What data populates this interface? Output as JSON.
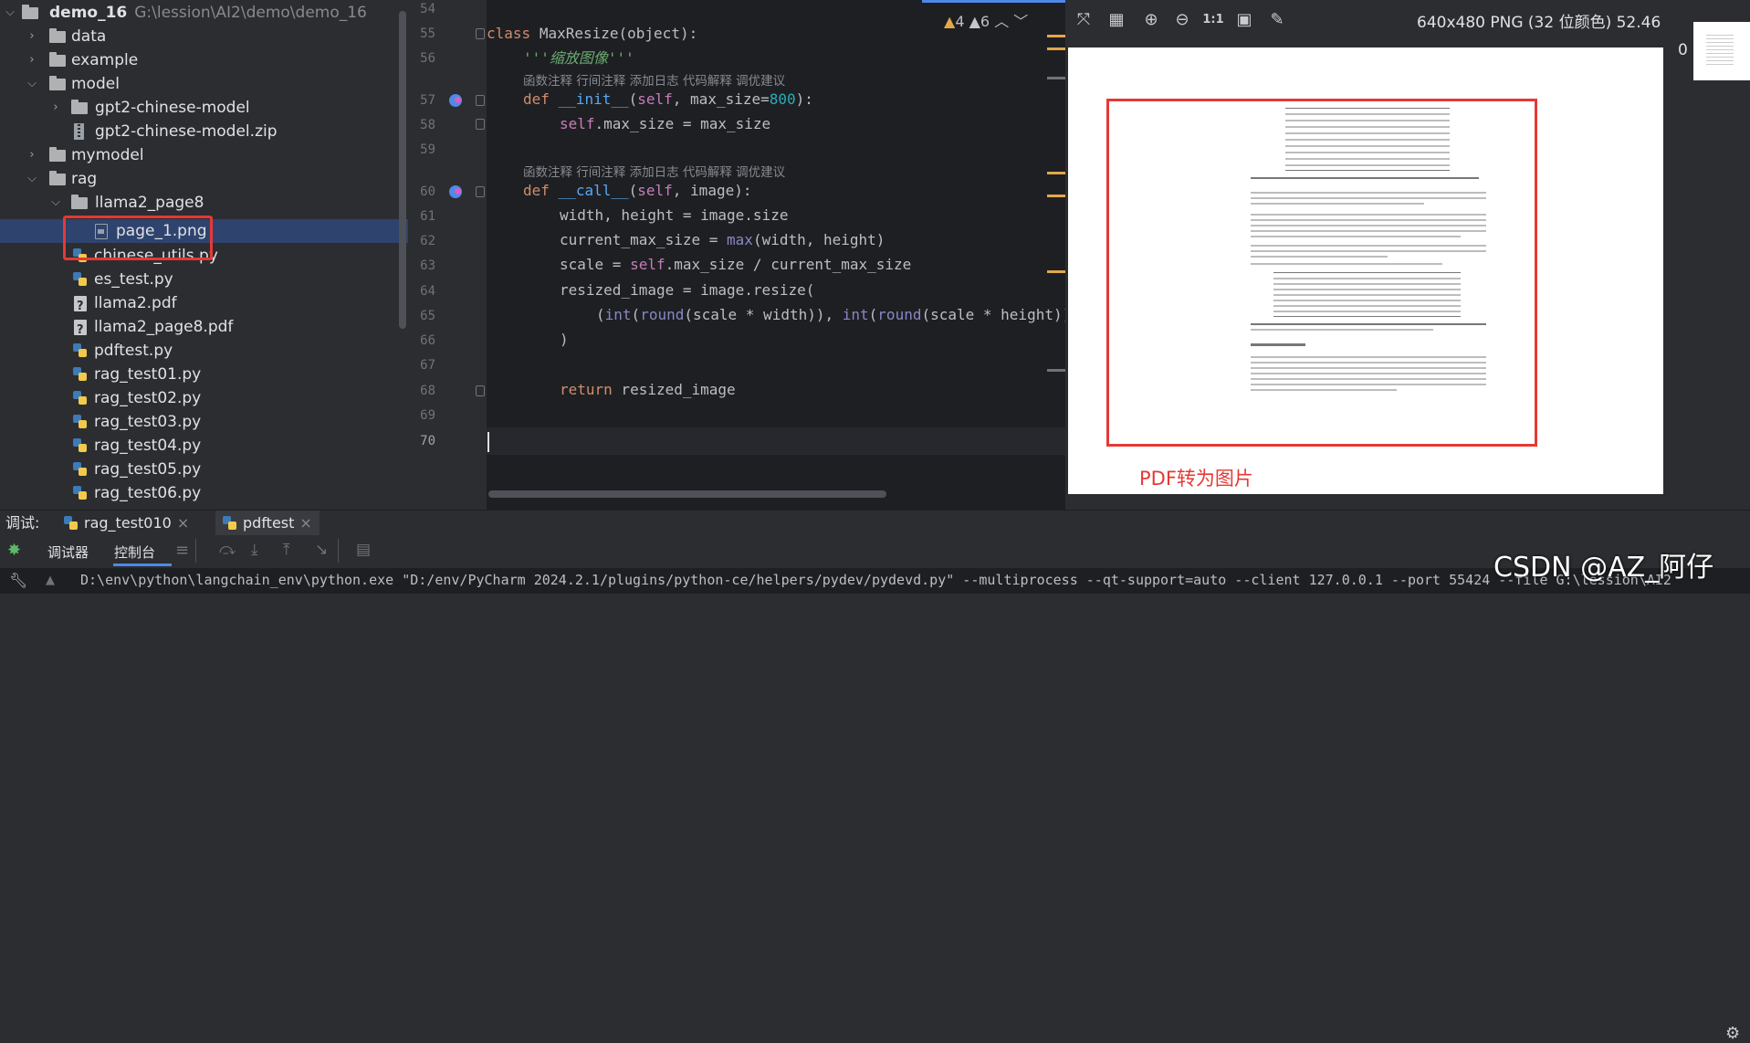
{
  "tree": {
    "root": {
      "name": "demo_16",
      "path": "G:\\lession\\AI2\\demo\\demo_16"
    },
    "items": [
      {
        "label": "data",
        "kind": "folder",
        "state": "collapsed"
      },
      {
        "label": "example",
        "kind": "folder",
        "state": "collapsed"
      },
      {
        "label": "model",
        "kind": "folder",
        "state": "expanded"
      },
      {
        "label": "gpt2-chinese-model",
        "kind": "folder",
        "state": "collapsed"
      },
      {
        "label": "gpt2-chinese-model.zip",
        "kind": "zip"
      },
      {
        "label": "mymodel",
        "kind": "folder",
        "state": "collapsed"
      },
      {
        "label": "rag",
        "kind": "folder",
        "state": "expanded"
      },
      {
        "label": "llama2_page8",
        "kind": "folder",
        "state": "expanded"
      },
      {
        "label": "page_1.png",
        "kind": "png",
        "selected": true
      },
      {
        "label": "chinese_utils.py",
        "kind": "py"
      },
      {
        "label": "es_test.py",
        "kind": "py"
      },
      {
        "label": "llama2.pdf",
        "kind": "pdf"
      },
      {
        "label": "llama2_page8.pdf",
        "kind": "pdf"
      },
      {
        "label": "pdftest.py",
        "kind": "py"
      },
      {
        "label": "rag_test01.py",
        "kind": "py"
      },
      {
        "label": "rag_test02.py",
        "kind": "py"
      },
      {
        "label": "rag_test03.py",
        "kind": "py"
      },
      {
        "label": "rag_test04.py",
        "kind": "py"
      },
      {
        "label": "rag_test05.py",
        "kind": "py"
      },
      {
        "label": "rag_test06.py",
        "kind": "py"
      }
    ]
  },
  "editor": {
    "line_numbers": [
      "54",
      "55",
      "56",
      "57",
      "58",
      "59",
      "60",
      "61",
      "62",
      "63",
      "64",
      "65",
      "66",
      "67",
      "68",
      "69",
      "70"
    ],
    "inlay_hints": "函数注释  行间注释  添加日志  代码解释  调优建议",
    "inspections": {
      "warnings": "4",
      "weak_warnings": "6"
    },
    "code": {
      "class_kw": "class",
      "class_name": "MaxResize",
      "class_base": "(object):",
      "docstring": "'''缩放图像'''",
      "def_kw": "def",
      "init_name": "__init__",
      "init_params_a": "(",
      "self_kw": "self",
      "init_params_b": ", max_size=",
      "init_default": "800",
      "init_params_c": "):",
      "assign_max_a": ".max_size = max_size",
      "call_name": "__call__",
      "call_params_b": ", image):",
      "line61": "width, height = image.size",
      "line62a": "current_max_size = ",
      "line62fn": "max",
      "line62b": "(width, height)",
      "line63a": "scale = ",
      "line63b": ".max_size / current_max_size",
      "line64": "resized_image = image.resize(",
      "line65a": "(",
      "int_fn": "int",
      "round_fn": "round",
      "line65b": "(scale * width)), ",
      "line65c": "(scale * height)))",
      "line66": ")",
      "return_kw": "return",
      "line68b": " resized_image"
    }
  },
  "image_viewer": {
    "info": "640x480 PNG (32 位颜色) 52.46 kB",
    "zoom_label": "1:1",
    "annotation": "PDF转为图片",
    "side_count": "0"
  },
  "run_tabs": {
    "label": "调试:",
    "tabs": [
      "rag_test010",
      "pdftest"
    ]
  },
  "run_toolbar": {
    "debugger": "调试器",
    "console": "控制台"
  },
  "console": {
    "command": "D:\\env\\python\\langchain_env\\python.exe \"D:/env/PyCharm 2024.2.1/plugins/python-ce/helpers/pydev/pydevd.py\" --multiprocess --qt-support=auto --client 127.0.0.1 --port 55424 --file G:\\lession\\AI2"
  },
  "watermark": "CSDN @AZ_阿仔",
  "colors": {
    "accent": "#4f89e8",
    "highlight_box": "#e53935",
    "warning": "#e2a84b",
    "selection": "#2e436e"
  }
}
